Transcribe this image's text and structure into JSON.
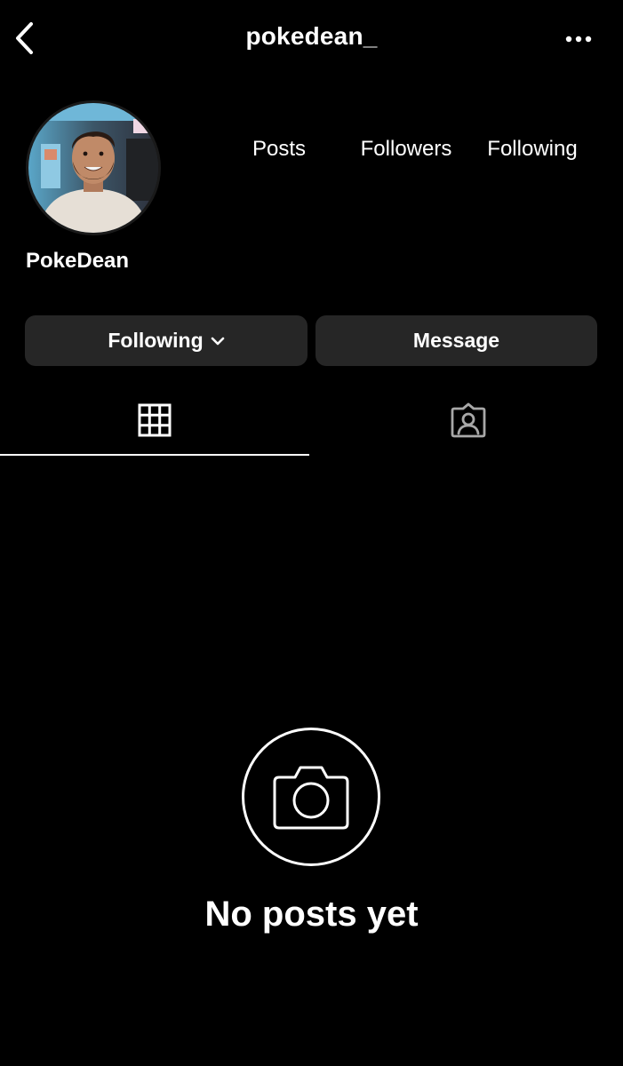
{
  "header": {
    "username": "pokedean_",
    "back_icon": "chevron-left-icon",
    "more_icon": "more-horizontal-icon"
  },
  "profile": {
    "display_name": "PokeDean",
    "avatar": "profile-photo"
  },
  "stats": {
    "posts_label": "Posts",
    "followers_label": "Followers",
    "following_label": "Following"
  },
  "actions": {
    "following_label": "Following",
    "following_icon": "chevron-down-icon",
    "message_label": "Message"
  },
  "tabs": [
    {
      "name": "grid",
      "icon": "grid-icon",
      "selected": true
    },
    {
      "name": "tagged",
      "icon": "tagged-person-icon",
      "selected": false
    }
  ],
  "empty_state": {
    "icon": "camera-icon",
    "title": "No posts yet"
  },
  "colors": {
    "background": "#000000",
    "text": "#ffffff",
    "button_bg": "#262626",
    "tab_icon_inactive": "#a8a8a8"
  }
}
